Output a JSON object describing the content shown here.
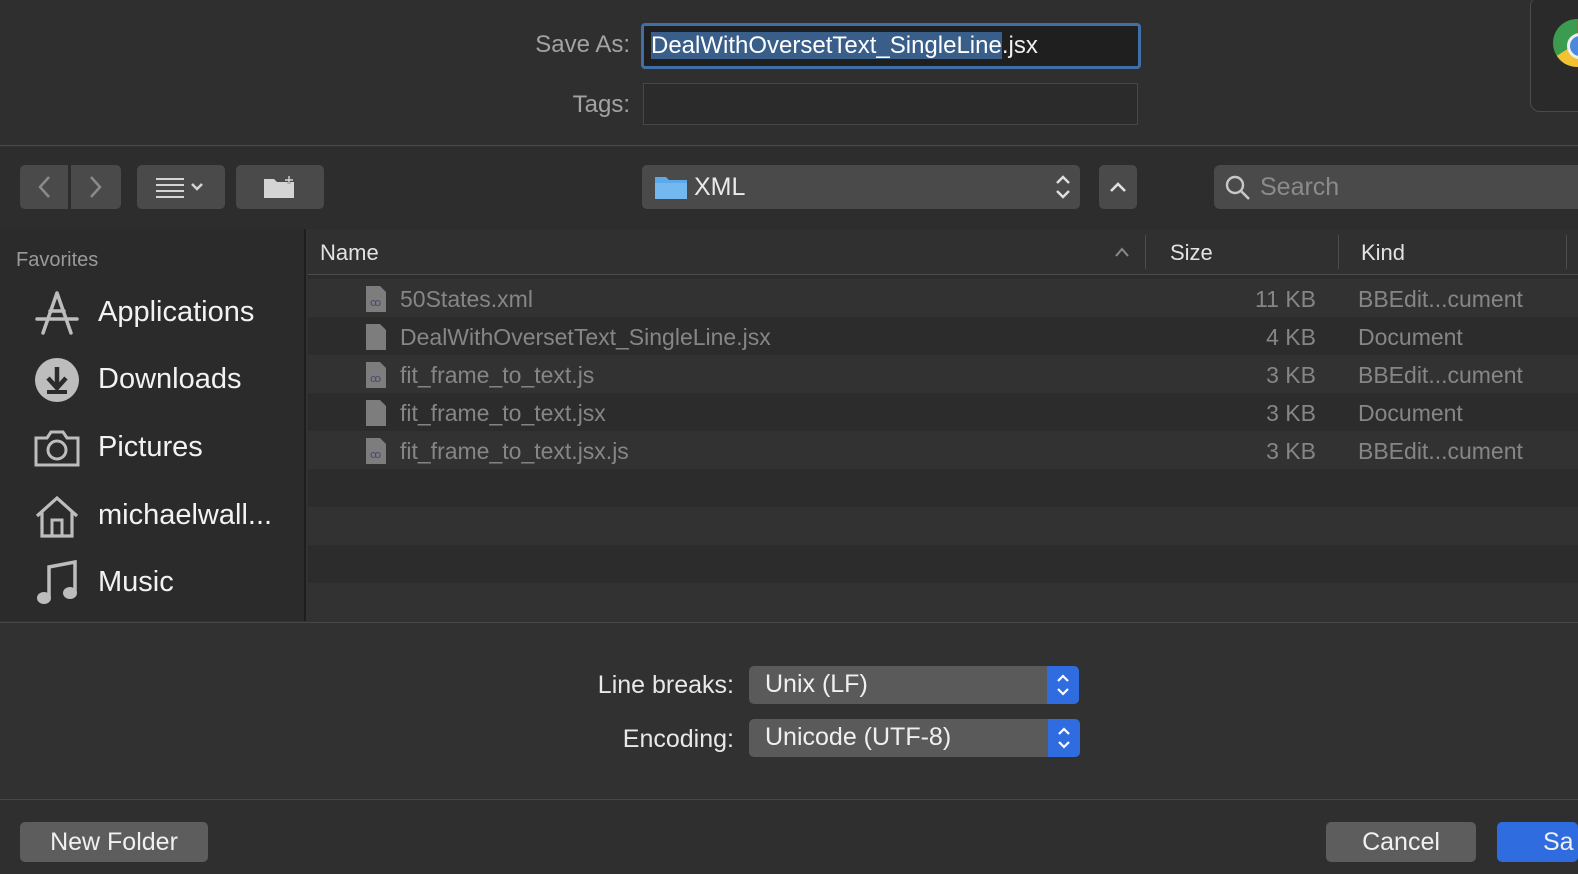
{
  "save_as": {
    "label": "Save As:",
    "filename_selected": "DealWithOversetText_SingleLine",
    "filename_ext": ".jsx"
  },
  "tags": {
    "label": "Tags:",
    "value": ""
  },
  "toolbar": {
    "location": "XML",
    "search_placeholder": "Search"
  },
  "sidebar": {
    "heading": "Favorites",
    "items": [
      {
        "label": "Applications",
        "icon": "applications-icon"
      },
      {
        "label": "Downloads",
        "icon": "downloads-icon"
      },
      {
        "label": "Pictures",
        "icon": "camera-icon"
      },
      {
        "label": "michaelwall...",
        "icon": "home-icon"
      },
      {
        "label": "Music",
        "icon": "music-note-icon"
      }
    ]
  },
  "file_list": {
    "columns": {
      "name": "Name",
      "size": "Size",
      "kind": "Kind"
    },
    "rows": [
      {
        "name": "50States.xml",
        "size": "11 KB",
        "kind": "BBEdit...cument",
        "icon": "bbedit-document-icon"
      },
      {
        "name": "DealWithOversetText_SingleLine.jsx",
        "size": "4 KB",
        "kind": "Document",
        "icon": "generic-document-icon"
      },
      {
        "name": "fit_frame_to_text.js",
        "size": "3 KB",
        "kind": "BBEdit...cument",
        "icon": "bbedit-document-icon"
      },
      {
        "name": "fit_frame_to_text.jsx",
        "size": "3 KB",
        "kind": "Document",
        "icon": "generic-document-icon"
      },
      {
        "name": "fit_frame_to_text.jsx.js",
        "size": "3 KB",
        "kind": "BBEdit...cument",
        "icon": "bbedit-document-icon"
      }
    ]
  },
  "options": {
    "line_breaks_label": "Line breaks:",
    "line_breaks_value": "Unix (LF)",
    "encoding_label": "Encoding:",
    "encoding_value": "Unicode (UTF-8)"
  },
  "buttons": {
    "new_folder": "New Folder",
    "cancel": "Cancel",
    "save": "Sa"
  },
  "colors": {
    "accent": "#2f6ce0",
    "focus_ring": "#3f6fa6",
    "background": "#323232"
  }
}
